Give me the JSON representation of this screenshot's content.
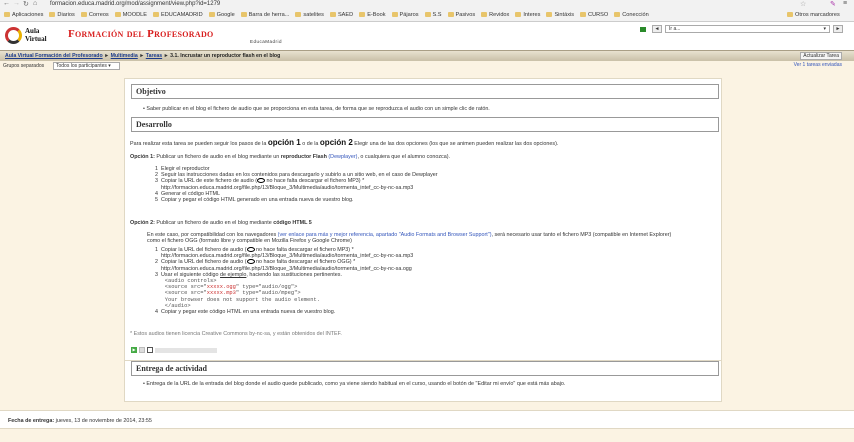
{
  "browser": {
    "url": "formacion.educa.madrid.org/mod/assignment/view.php?id=1279",
    "bookmarks": [
      "Aplicaciones",
      "Diarios",
      "Correos",
      "MOODLE",
      "EDUCAMADRID",
      "Google",
      "Barra de herra...",
      "satelites",
      "SAED",
      "E-Book",
      "Pájaros",
      "S.S",
      "Pasivos",
      "Revidox",
      "Interes",
      "Sintáxis",
      "CURSO",
      "Conección"
    ],
    "other_bookmarks": "Otros marcadores"
  },
  "header": {
    "logo_line1": "Aula",
    "logo_line2": "Virtual",
    "title": "Formación del Profesorado",
    "brand": "EducaMadrid",
    "jump_select": "Ir a..."
  },
  "breadcrumb": [
    "Aula Virtual Formación del Profesorado",
    "Multimedia",
    "Tareas",
    "3.1. Incrustar un reproductor flash en el blog"
  ],
  "update_button": "Actualizar Tarea",
  "groups": {
    "label": "Grupos separados",
    "value": "Todos los participantes"
  },
  "view_submissions": "Ver 1 tareas enviadas",
  "objetivo": {
    "title": "Objetivo",
    "bullet": "Saber publicar en el blog el fichero de audio que se proporciona en esta tarea, de forma que se reproduzca el audio con un simple clic de ratón."
  },
  "desarrollo": {
    "title": "Desarrollo",
    "intro_a": "Para realizar esta tarea se pueden seguir los pasos de la ",
    "op1": "opción 1",
    "intro_b": " o de la ",
    "op2": "opción 2",
    "intro_c": " Elegir una de las dos opciones (los que se animen pueden realizar las dos opciones).",
    "opt1_label": "Opción 1:",
    "opt1_a": " Publicar un fichero de audio en el blog mediante un ",
    "opt1_b": "reproductor Flash",
    "opt1_link": "(Dewplayer)",
    "opt1_c": ", o cualquiera que el alumno conozca).",
    "opt1_steps": [
      "Elegir el reproductor",
      "Seguir las instrucciones dadas en los contenidos para descargarlo y subirlo a un sitio web, en el caso de Dewplayer",
      "Copiar la URL de este fichero de audio (",
      "Generar el código HTML",
      "Copiar y pegar el código HTML generado en una entrada nueva de vuestro blog."
    ],
    "no_download_mp3": " no hace falta descargar el fichero MP3) *",
    "mp3_url": "http://formacion.educa.madrid.org/file.php/13/Bloque_3/Multimedia/audio/tormenta_intef_cc-by-nc-sa.mp3",
    "opt2_label": "Opción 2:",
    "opt2_a": " Publicar un fichero de audio en el blog mediante ",
    "opt2_b": "código HTML 5",
    "opt2_p1a": "En este caso, por compatibilidad con los navegadores ",
    "opt2_link": "(ver enlace para más y mejor referencia, apartado \"Audio Formats and Browser Support\")",
    "opt2_p1b": ", será necesario usar tanto el fichero MP3 (compatible en Internet Explorer)",
    "opt2_p1c": "como el fichero OGG (formato libre y compatible en Mozilla Firefox y Google Chrome)",
    "opt2_s1": "Copiar la URL del fichero de audio (",
    "opt2_s2": "Copiar la URL del fichero de audio (",
    "no_download_ogg": " no hace falta descargar el fichero OGG) *",
    "ogg_url": "http://formacion.educa.madrid.org/file.php/13/Bloque_3/Multimedia/audio/tormenta_intef_cc-by-nc-sa.ogg",
    "opt2_s3a": "Usar el siguiente código ",
    "opt2_s3link": "de ejemplo",
    "opt2_s3b": ", haciendo las sustituciones pertinentes.",
    "code": [
      "<audio controls>",
      "<source src=\"",
      "xxxxx.ogg",
      "\" type=\"audio/ogg\">",
      "<source src=\"",
      "xxxxx.mp3",
      "\" type=\"audio/mpeg\">",
      "Your browser does not support the audio element.",
      "</audio>"
    ],
    "opt2_s4": "Copiar y pegar este código HTML en una entrada nueva de vuestro blog.",
    "license": "* Estos audios tienen licencia Creative Commons by-nc-sa, y están obtenidos del INTEF."
  },
  "entrega": {
    "title": "Entrega de actividad",
    "bullet": "Entrega de la URL de la entrada del blog donde el audio quede publicado, como ya viene siendo habitual en el curso, usando el botón de \"Editar mi envío\" que está más abajo."
  },
  "footer": {
    "due_label": "Fecha de entrega:",
    "due_value": " jueves, 13 de noviembre de 2014, 23:55"
  }
}
